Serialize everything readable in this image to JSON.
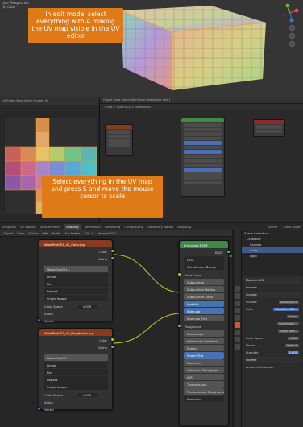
{
  "viewport": {
    "header_line1": "User Perspective",
    "header_line2": "(0) Cube",
    "callout": "In edit mode, select everything with A making the UV map visible in the UV editor"
  },
  "uv_editor": {
    "header": "UV Editor  View  Select  Image  UV",
    "callout": "Select everything in the UV map and press S and move the mouse cursor to scale"
  },
  "shader_mini": {
    "bar": "Object  View  Select  Add  Node  Use Nodes   Slot 1",
    "bar2": "Cube  >  Cube.001  >  Material.001"
  },
  "shading": {
    "tabs": [
      "Sculpting",
      "UV Editing",
      "Texture Paint",
      "Shading",
      "Animation",
      "Rendering",
      "Compositing",
      "Geometry Nodes",
      "Scripting"
    ],
    "active_tab": "Shading",
    "header_items": [
      "Object",
      "View",
      "Select",
      "Add",
      "Node",
      "Use Nodes",
      "Slot 1",
      "Material.001"
    ],
    "scene": "Scene",
    "view_layer": "View Layer",
    "node1": {
      "title": "WoodFine001_4K_Color.jpg",
      "out_color": "Color",
      "out_alpha": "Alpha",
      "image": "WoodFine001...",
      "interp": "Linear",
      "proj": "Flat",
      "ext": "Repeat",
      "src": "Single Image",
      "colorspace_label": "Color Space",
      "colorspace_value": "sRGB",
      "alpha_label": "Alpha",
      "vector": "Vector"
    },
    "node2": {
      "title": "WoodFine001_4K_Roughness.jpg",
      "out_color": "Color",
      "out_alpha": "Alpha",
      "image": "WoodFine001...",
      "interp": "Linear",
      "proj": "Flat",
      "ext": "Repeat",
      "src": "Single Image",
      "colorspace_label": "Color Space",
      "colorspace_value": "sRGB",
      "alpha_label": "Alpha",
      "vector": "Vector"
    },
    "bsdf": {
      "title": "Principled BSDF",
      "out": "BSDF",
      "distribution": "GGX",
      "subsurface_method": "Christensen-Burley",
      "rows": [
        "Base Color",
        "Subsurface",
        "Subsurface Radius",
        "Subsurface Color",
        "Metallic",
        "Specular",
        "Specular Tint",
        "Roughness",
        "Anisotropic",
        "Anisotropic Rotation",
        "Sheen",
        "Sheen Tint",
        "Clearcoat",
        "Clearcoat Roughness",
        "IOR",
        "Transmission",
        "Transmission Roughness",
        "Emission"
      ]
    },
    "outliner": {
      "items": [
        "Scene Collection",
        "Collection",
        "Camera",
        "Cube",
        "Light"
      ]
    },
    "properties": {
      "material": "Material.001",
      "preview": "Preview",
      "surface": "Surface",
      "surface_value": "Background",
      "color_label": "Color",
      "color_value": "WoodFine001...",
      "linear": "Linear",
      "equirect": "Equirectan...",
      "single": "Single Ima...",
      "color_space": "sRGB",
      "vector": "Default",
      "strength_label": "Strength",
      "strength_value": "1.000",
      "volume": "Volume",
      "ambient": "Ambient Occlusion"
    }
  }
}
